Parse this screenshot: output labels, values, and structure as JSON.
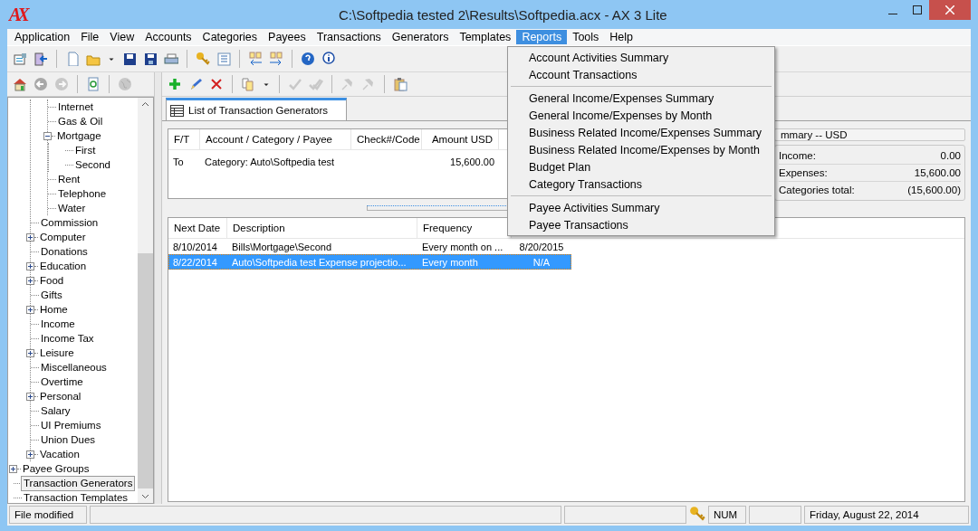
{
  "window": {
    "logo": "AX",
    "title": "C:\\Softpedia tested 2\\Results\\Softpedia.acx - AX 3 Lite"
  },
  "menu_bar": [
    {
      "label": "Application",
      "selected": false
    },
    {
      "label": "File",
      "selected": false
    },
    {
      "label": "View",
      "selected": false
    },
    {
      "label": "Accounts",
      "selected": false
    },
    {
      "label": "Categories",
      "selected": false
    },
    {
      "label": "Payees",
      "selected": false
    },
    {
      "label": "Transactions",
      "selected": false
    },
    {
      "label": "Generators",
      "selected": false
    },
    {
      "label": "Templates",
      "selected": false
    },
    {
      "label": "Reports",
      "selected": true
    },
    {
      "label": "Tools",
      "selected": false
    },
    {
      "label": "Help",
      "selected": false
    }
  ],
  "main_toolbar": [
    {
      "kind": "properties",
      "disabled": false
    },
    {
      "kind": "exit",
      "disabled": false
    },
    {
      "kind": "separator"
    },
    {
      "kind": "new",
      "disabled": false
    },
    {
      "kind": "open",
      "disabled": false
    },
    {
      "kind": "dropdown",
      "disabled": false
    },
    {
      "kind": "save",
      "disabled": false
    },
    {
      "kind": "saveas",
      "disabled": false
    },
    {
      "kind": "print",
      "disabled": false
    },
    {
      "kind": "separator"
    },
    {
      "kind": "key",
      "disabled": false
    },
    {
      "kind": "list",
      "disabled": false
    },
    {
      "kind": "separator"
    },
    {
      "kind": "copyleft",
      "disabled": false
    },
    {
      "kind": "copyright",
      "disabled": false
    },
    {
      "kind": "separator"
    },
    {
      "kind": "help",
      "disabled": false
    },
    {
      "kind": "info",
      "disabled": false
    }
  ],
  "nav_toolbar": [
    {
      "kind": "home",
      "disabled": false
    },
    {
      "kind": "back",
      "disabled": false
    },
    {
      "kind": "forward",
      "disabled": true
    },
    {
      "kind": "separator"
    },
    {
      "kind": "refresh",
      "disabled": false
    },
    {
      "kind": "separator"
    },
    {
      "kind": "globe",
      "disabled": true
    }
  ],
  "edit_toolbar": [
    {
      "kind": "add",
      "disabled": false
    },
    {
      "kind": "edit",
      "disabled": false
    },
    {
      "kind": "delete",
      "disabled": false
    },
    {
      "kind": "separator"
    },
    {
      "kind": "copy",
      "disabled": false
    },
    {
      "kind": "dropdown",
      "disabled": false
    },
    {
      "kind": "separator"
    },
    {
      "kind": "check",
      "disabled": true
    },
    {
      "kind": "doublecheck",
      "disabled": true
    },
    {
      "kind": "separator"
    },
    {
      "kind": "pin",
      "disabled": true
    },
    {
      "kind": "pin",
      "disabled": true
    },
    {
      "kind": "separator"
    },
    {
      "kind": "clipboard",
      "disabled": false
    }
  ],
  "tree": [
    {
      "children": [
        {
          "children": [
            {
              "label": "Internet",
              "selected": false
            },
            {
              "label": "Gas & Oil",
              "selected": false
            },
            {
              "label": "Mortgage",
              "selected": false,
              "expanded": true,
              "children": [
                {
                  "label": "First",
                  "selected": false
                },
                {
                  "label": "Second",
                  "selected": false
                }
              ]
            },
            {
              "label": "Rent",
              "selected": false
            },
            {
              "label": "Telephone",
              "selected": false
            },
            {
              "label": "Water",
              "selected": false
            }
          ]
        },
        {
          "label": "Commission",
          "selected": false
        },
        {
          "label": "Computer",
          "selected": false,
          "expanded": false
        },
        {
          "label": "Donations",
          "selected": false
        },
        {
          "label": "Education",
          "selected": false,
          "expanded": false
        },
        {
          "label": "Food",
          "selected": false,
          "expanded": false
        },
        {
          "label": "Gifts",
          "selected": false
        },
        {
          "label": "Home",
          "selected": false,
          "expanded": false
        },
        {
          "label": "Income",
          "selected": false
        },
        {
          "label": "Income Tax",
          "selected": false
        },
        {
          "label": "Leisure",
          "selected": false,
          "expanded": false
        },
        {
          "label": "Miscellaneous",
          "selected": false
        },
        {
          "label": "Overtime",
          "selected": false
        },
        {
          "label": "Personal",
          "selected": false,
          "expanded": false
        },
        {
          "label": "Salary",
          "selected": false
        },
        {
          "label": "UI Premiums",
          "selected": false
        },
        {
          "label": "Union Dues",
          "selected": false
        },
        {
          "label": "Vacation",
          "selected": false,
          "expanded": false
        }
      ]
    },
    {
      "label": "Payee Groups",
      "selected": false,
      "expanded": false
    },
    {
      "label": "Transaction Generators",
      "selected": true
    },
    {
      "label": "Transaction Templates",
      "selected": false
    }
  ],
  "tab": {
    "label": "List of Transaction Generators",
    "selected": true
  },
  "splits_table": {
    "columns": [
      "F/T",
      "Account / Category / Payee",
      "Check#/Code",
      "Amount USD"
    ],
    "rows": [
      [
        "To",
        "Category: Auto\\Softpedia test",
        "",
        "15,600.00"
      ]
    ]
  },
  "summary": {
    "title": "mmary -- USD",
    "rows": [
      {
        "label": "Income:",
        "value": "0.00"
      },
      {
        "label": "Expenses:",
        "value": "15,600.00"
      },
      {
        "label": "Categories total:",
        "value": "(15,600.00)"
      }
    ]
  },
  "generators_table": {
    "columns": [
      "Next Date",
      "Description",
      "Frequency"
    ],
    "rows": [
      {
        "cells": [
          "8/10/2014",
          "Bills\\Mortgage\\Second",
          "Every month on ...",
          "8/20/2015"
        ],
        "selected": false
      },
      {
        "cells": [
          "8/22/2014",
          "Auto\\Softpedia test Expense projectio...",
          "Every month",
          "N/A"
        ],
        "selected": true
      }
    ]
  },
  "reports_menu": [
    {
      "kind": "item",
      "label": "Account Activities Summary"
    },
    {
      "kind": "item",
      "label": "Account Transactions"
    },
    {
      "kind": "separator"
    },
    {
      "kind": "item",
      "label": "General Income/Expenses Summary"
    },
    {
      "kind": "item",
      "label": "General Income/Expenses by Month"
    },
    {
      "kind": "item",
      "label": "Business Related Income/Expenses Summary"
    },
    {
      "kind": "item",
      "label": "Business Related Income/Expenses by Month"
    },
    {
      "kind": "item",
      "label": "Budget Plan"
    },
    {
      "kind": "item",
      "label": "Category Transactions"
    },
    {
      "kind": "separator"
    },
    {
      "kind": "item",
      "label": "Payee Activities Summary"
    },
    {
      "kind": "item",
      "label": "Payee Transactions"
    }
  ],
  "status_bar": [
    {
      "kind": "text",
      "text": "File modified"
    },
    {
      "kind": "blank"
    },
    {
      "kind": "blank"
    },
    {
      "kind": "key"
    },
    {
      "kind": "text",
      "text": "NUM"
    },
    {
      "kind": "blank"
    },
    {
      "kind": "text",
      "text": "Friday, August 22, 2014"
    }
  ]
}
